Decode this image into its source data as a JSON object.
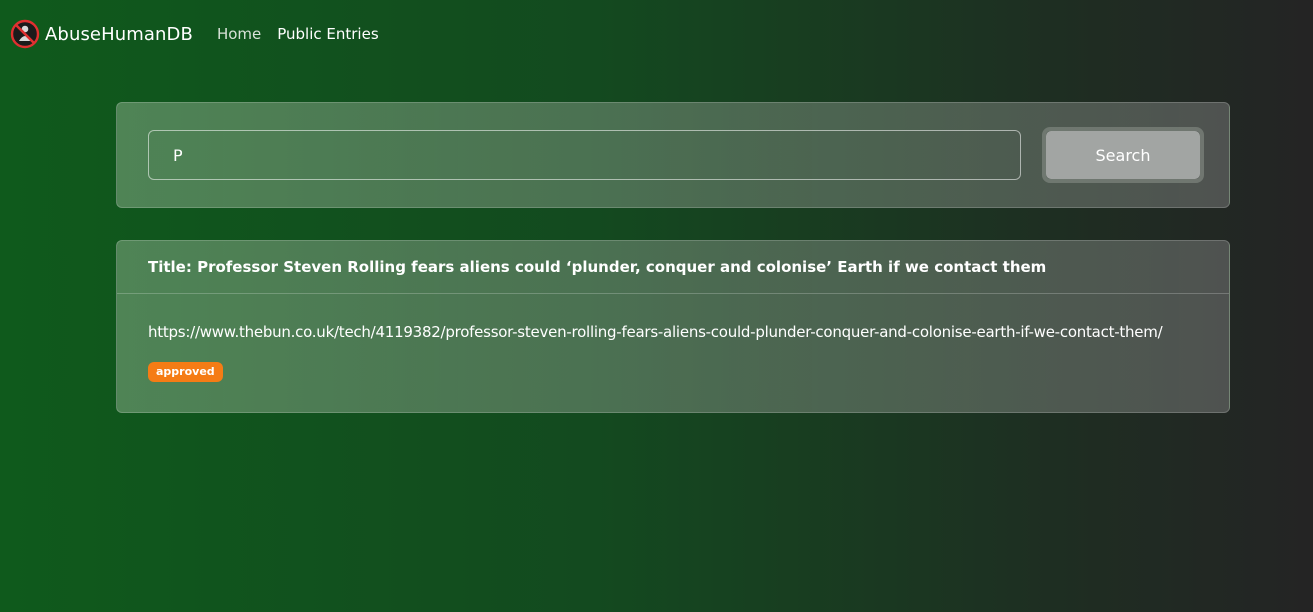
{
  "nav": {
    "brand": "AbuseHumanDB",
    "brand_icon": "no-human-icon",
    "links": [
      {
        "label": "Home"
      },
      {
        "label": "Public Entries"
      }
    ]
  },
  "search": {
    "value": "P",
    "button_label": "Search"
  },
  "results": [
    {
      "title": "Title: Professor Steven Rolling fears aliens could ‘plunder, conquer and colonise’ Earth if we contact them",
      "url": "https://www.thebun.co.uk/tech/4119382/professor-steven-rolling-fears-aliens-could-plunder-conquer-and-colonise-earth-if-we-contact-them/",
      "status": "approved"
    }
  ],
  "colors": {
    "badge": "#f57c15",
    "button": "#a2a5a3",
    "background_start": "#0f5a1c",
    "background_end": "#242424"
  }
}
